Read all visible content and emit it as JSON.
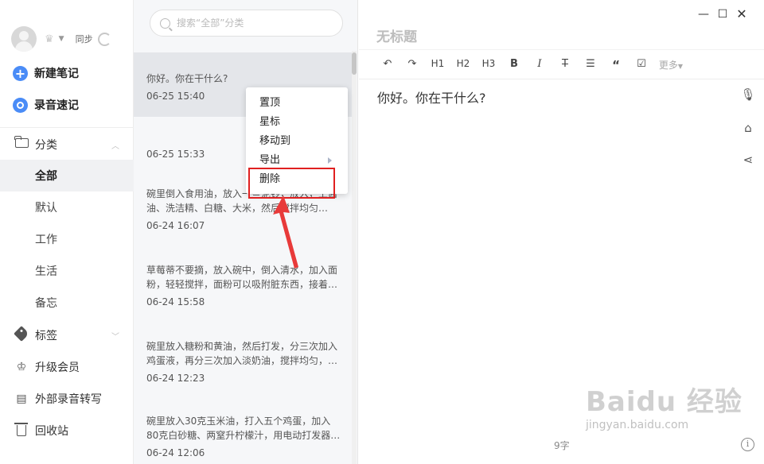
{
  "sidebar": {
    "sync_label": "同步",
    "new_note": "新建笔记",
    "voice_note": "录音速记",
    "category": "分类",
    "sub_items": [
      "全部",
      "默认",
      "工作",
      "生活",
      "备忘"
    ],
    "tags": "标签",
    "upgrade": "升级会员",
    "external_transcribe": "外部录音转写",
    "trash": "回收站"
  },
  "list": {
    "search_placeholder": "搜索“全部”分类",
    "notes": [
      {
        "excerpt": "你好。你在干什么?",
        "time": "06-25 15:40"
      },
      {
        "excerpt": "",
        "time": "06-25 15:33"
      },
      {
        "excerpt": "碗里倒入食用油，放入一些泥钞，放入，上酱油、洗洁精、白糖、大米，然后搅拌均匀…",
        "time": "06-24 16:07"
      },
      {
        "excerpt": "草莓蒂不要摘，放入碗中，倒入清水，加入面粉，轻轻搅拌，面粉可以吸附脏东西，接着…",
        "time": "06-24 15:58"
      },
      {
        "excerpt": "碗里放入糖粉和黄油，然后打发，分三次加入鸡蛋液，再分三次加入淡奶油，搅拌均匀，…",
        "time": "06-24 12:23"
      },
      {
        "excerpt": "碗里放入30克玉米油，打入五个鸡蛋，加入80克白砂糖、两窒升柠檬汁，用电动打发器…",
        "time": "06-24 12:06"
      }
    ]
  },
  "context_menu": {
    "items": [
      "置顶",
      "星标",
      "移动到",
      "导出",
      "删除"
    ]
  },
  "editor": {
    "title_placeholder": "无标题",
    "toolbar": [
      "H1",
      "H2",
      "H3",
      "B",
      "I",
      "“",
      "更多"
    ],
    "content": "你好。你在干什么?",
    "word_count": "9字"
  },
  "watermark": {
    "line1": "Baidu 经验",
    "line2": "jingyan.baidu.com"
  },
  "colors": {
    "accent": "#4a8cf7",
    "highlight": "#e02020",
    "selected_bg": "#e4e6ea"
  }
}
